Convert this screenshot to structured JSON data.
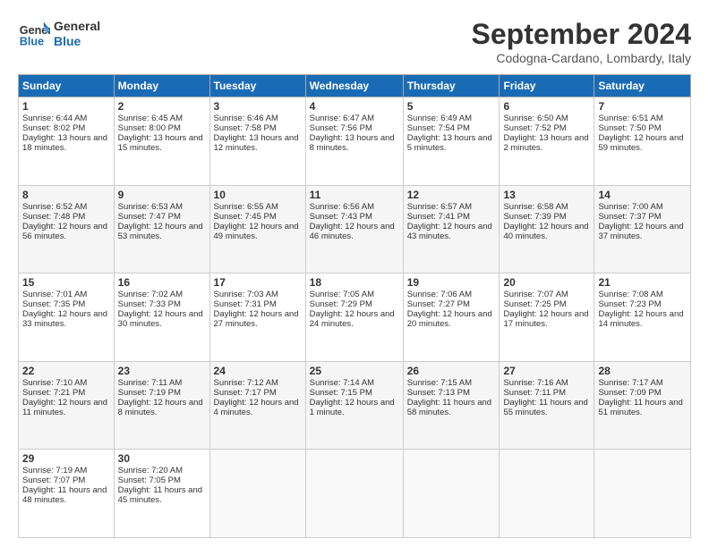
{
  "header": {
    "logo_line1": "General",
    "logo_line2": "Blue",
    "month_year": "September 2024",
    "location": "Codogna-Cardano, Lombardy, Italy"
  },
  "days_of_week": [
    "Sunday",
    "Monday",
    "Tuesday",
    "Wednesday",
    "Thursday",
    "Friday",
    "Saturday"
  ],
  "weeks": [
    [
      {
        "day": "1",
        "info": "Sunrise: 6:44 AM\nSunset: 8:02 PM\nDaylight: 13 hours and 18 minutes."
      },
      {
        "day": "2",
        "info": "Sunrise: 6:45 AM\nSunset: 8:00 PM\nDaylight: 13 hours and 15 minutes."
      },
      {
        "day": "3",
        "info": "Sunrise: 6:46 AM\nSunset: 7:58 PM\nDaylight: 13 hours and 12 minutes."
      },
      {
        "day": "4",
        "info": "Sunrise: 6:47 AM\nSunset: 7:56 PM\nDaylight: 13 hours and 8 minutes."
      },
      {
        "day": "5",
        "info": "Sunrise: 6:49 AM\nSunset: 7:54 PM\nDaylight: 13 hours and 5 minutes."
      },
      {
        "day": "6",
        "info": "Sunrise: 6:50 AM\nSunset: 7:52 PM\nDaylight: 13 hours and 2 minutes."
      },
      {
        "day": "7",
        "info": "Sunrise: 6:51 AM\nSunset: 7:50 PM\nDaylight: 12 hours and 59 minutes."
      }
    ],
    [
      {
        "day": "8",
        "info": "Sunrise: 6:52 AM\nSunset: 7:48 PM\nDaylight: 12 hours and 56 minutes."
      },
      {
        "day": "9",
        "info": "Sunrise: 6:53 AM\nSunset: 7:47 PM\nDaylight: 12 hours and 53 minutes."
      },
      {
        "day": "10",
        "info": "Sunrise: 6:55 AM\nSunset: 7:45 PM\nDaylight: 12 hours and 49 minutes."
      },
      {
        "day": "11",
        "info": "Sunrise: 6:56 AM\nSunset: 7:43 PM\nDaylight: 12 hours and 46 minutes."
      },
      {
        "day": "12",
        "info": "Sunrise: 6:57 AM\nSunset: 7:41 PM\nDaylight: 12 hours and 43 minutes."
      },
      {
        "day": "13",
        "info": "Sunrise: 6:58 AM\nSunset: 7:39 PM\nDaylight: 12 hours and 40 minutes."
      },
      {
        "day": "14",
        "info": "Sunrise: 7:00 AM\nSunset: 7:37 PM\nDaylight: 12 hours and 37 minutes."
      }
    ],
    [
      {
        "day": "15",
        "info": "Sunrise: 7:01 AM\nSunset: 7:35 PM\nDaylight: 12 hours and 33 minutes."
      },
      {
        "day": "16",
        "info": "Sunrise: 7:02 AM\nSunset: 7:33 PM\nDaylight: 12 hours and 30 minutes."
      },
      {
        "day": "17",
        "info": "Sunrise: 7:03 AM\nSunset: 7:31 PM\nDaylight: 12 hours and 27 minutes."
      },
      {
        "day": "18",
        "info": "Sunrise: 7:05 AM\nSunset: 7:29 PM\nDaylight: 12 hours and 24 minutes."
      },
      {
        "day": "19",
        "info": "Sunrise: 7:06 AM\nSunset: 7:27 PM\nDaylight: 12 hours and 20 minutes."
      },
      {
        "day": "20",
        "info": "Sunrise: 7:07 AM\nSunset: 7:25 PM\nDaylight: 12 hours and 17 minutes."
      },
      {
        "day": "21",
        "info": "Sunrise: 7:08 AM\nSunset: 7:23 PM\nDaylight: 12 hours and 14 minutes."
      }
    ],
    [
      {
        "day": "22",
        "info": "Sunrise: 7:10 AM\nSunset: 7:21 PM\nDaylight: 12 hours and 11 minutes."
      },
      {
        "day": "23",
        "info": "Sunrise: 7:11 AM\nSunset: 7:19 PM\nDaylight: 12 hours and 8 minutes."
      },
      {
        "day": "24",
        "info": "Sunrise: 7:12 AM\nSunset: 7:17 PM\nDaylight: 12 hours and 4 minutes."
      },
      {
        "day": "25",
        "info": "Sunrise: 7:14 AM\nSunset: 7:15 PM\nDaylight: 12 hours and 1 minute."
      },
      {
        "day": "26",
        "info": "Sunrise: 7:15 AM\nSunset: 7:13 PM\nDaylight: 11 hours and 58 minutes."
      },
      {
        "day": "27",
        "info": "Sunrise: 7:16 AM\nSunset: 7:11 PM\nDaylight: 11 hours and 55 minutes."
      },
      {
        "day": "28",
        "info": "Sunrise: 7:17 AM\nSunset: 7:09 PM\nDaylight: 11 hours and 51 minutes."
      }
    ],
    [
      {
        "day": "29",
        "info": "Sunrise: 7:19 AM\nSunset: 7:07 PM\nDaylight: 11 hours and 48 minutes."
      },
      {
        "day": "30",
        "info": "Sunrise: 7:20 AM\nSunset: 7:05 PM\nDaylight: 11 hours and 45 minutes."
      },
      {
        "day": "",
        "info": ""
      },
      {
        "day": "",
        "info": ""
      },
      {
        "day": "",
        "info": ""
      },
      {
        "day": "",
        "info": ""
      },
      {
        "day": "",
        "info": ""
      }
    ]
  ]
}
